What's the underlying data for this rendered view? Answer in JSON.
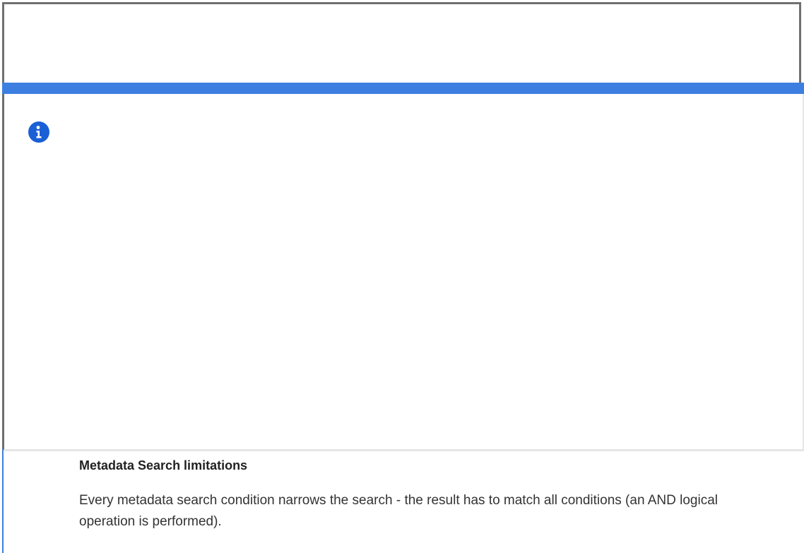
{
  "note": {
    "icon": "info-icon",
    "title": "Metadata Search limitations",
    "body": "Every metadata search condition narrows the search - the result has to match all conditions (an AND logical operation is performed)."
  },
  "colors": {
    "accent": "#3d7fe0",
    "icon": "#1a5fd6",
    "frame": "#707070"
  }
}
